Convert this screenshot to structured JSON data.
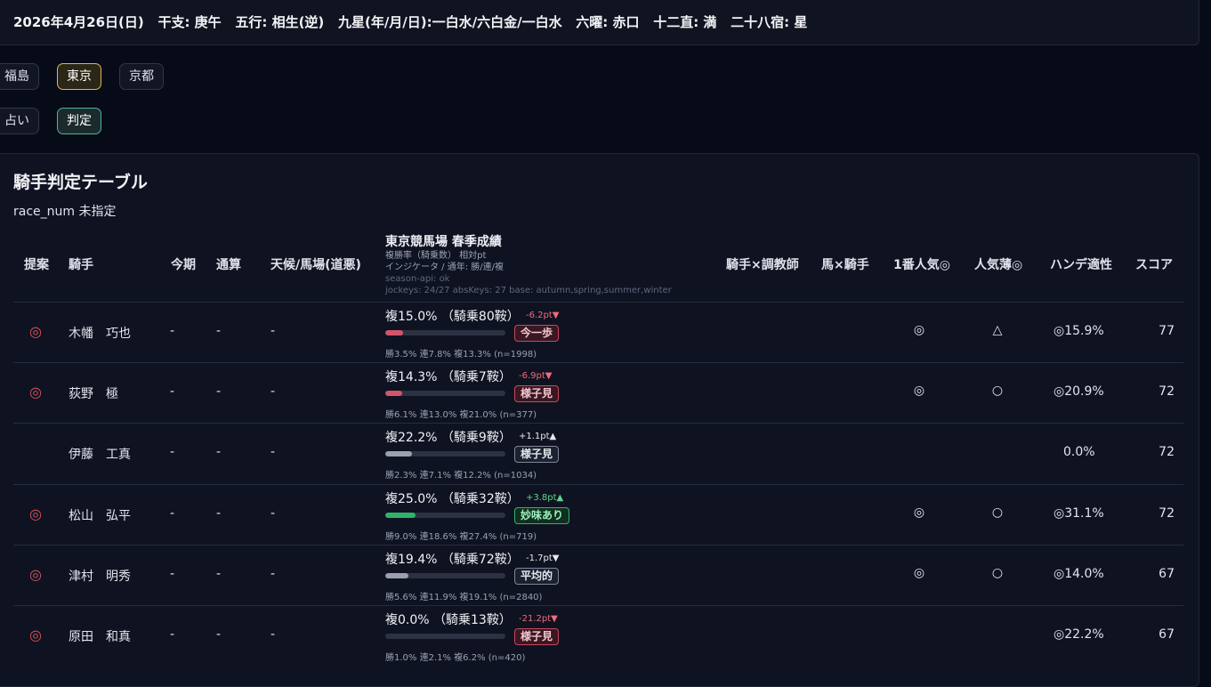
{
  "header": {
    "date": "2026年4月26日(日)",
    "eto": "干支: 庚午",
    "gogyo": "五行: 相生(逆)",
    "kusei": "九星(年/月/日):一白水/六白金/一白水",
    "rokuyo": "六曜: 赤口",
    "junichoku": "十二直: 満",
    "nijuhasshuku": "二十八宿: 星"
  },
  "venues": [
    "福島",
    "東京",
    "京都"
  ],
  "active_venue": "東京",
  "modes": [
    "占い",
    "判定"
  ],
  "active_mode": "判定",
  "panel": {
    "title": "騎手判定テーブル",
    "subtitle": "race_num 未指定"
  },
  "table": {
    "headers": {
      "suggest": "提案",
      "jockey": "騎手",
      "current": "今期",
      "total": "通算",
      "weather": "天候/馬場(道悪)",
      "venue_title": "東京競馬場 春季成績",
      "venue_line1": "複勝率（騎乗数） 相対pt",
      "venue_line2": "インジケータ / 通年: 勝/連/複",
      "venue_line3": "season-api: ok",
      "venue_line4": "jockeys: 24/27 absKeys: 27 base: autumn,spring,summer,winter",
      "trainer": "騎手×調教師",
      "horse": "馬×騎手",
      "fav1": "1番人気◎",
      "longshot": "人気薄◎",
      "handicap": "ハンデ適性",
      "score": "スコア"
    },
    "rows": [
      {
        "mark": "◎",
        "name": "木幡　巧也",
        "current": "-",
        "total": "-",
        "weather": "-",
        "rate": "複15.0% （騎乗80鞍）",
        "rate_value": 15.0,
        "delta": "-6.2pt▼",
        "delta_dir": "neg",
        "badge": "今一歩",
        "badge_kind": "red",
        "sub": "勝3.5% 連7.8% 複13.3% (n=1998)",
        "fav1": "◎",
        "longshot": "△",
        "handicap": "◎15.9%",
        "score": "77"
      },
      {
        "mark": "◎",
        "name": "荻野　極",
        "current": "-",
        "total": "-",
        "weather": "-",
        "rate": "複14.3% （騎乗7鞍）",
        "rate_value": 14.3,
        "delta": "-6.9pt▼",
        "delta_dir": "neg",
        "badge": "様子見",
        "badge_kind": "red",
        "sub": "勝6.1% 連13.0% 複21.0% (n=377)",
        "fav1": "◎",
        "longshot": "○",
        "handicap": "◎20.9%",
        "score": "72"
      },
      {
        "mark": "",
        "name": "伊藤　工真",
        "current": "-",
        "total": "-",
        "weather": "-",
        "rate": "複22.2% （騎乗9鞍）",
        "rate_value": 22.2,
        "delta": "+1.1pt▲",
        "delta_dir": "neu",
        "badge": "様子見",
        "badge_kind": "gray",
        "sub": "勝2.3% 連7.1% 複12.2% (n=1034)",
        "fav1": "",
        "longshot": "",
        "handicap": "0.0%",
        "score": "72"
      },
      {
        "mark": "◎",
        "name": "松山　弘平",
        "current": "-",
        "total": "-",
        "weather": "-",
        "rate": "複25.0% （騎乗32鞍）",
        "rate_value": 25.0,
        "delta": "+3.8pt▲",
        "delta_dir": "pos",
        "badge": "妙味あり",
        "badge_kind": "green",
        "sub": "勝9.0% 連18.6% 複27.4% (n=719)",
        "fav1": "◎",
        "longshot": "○",
        "handicap": "◎31.1%",
        "score": "72"
      },
      {
        "mark": "◎",
        "name": "津村　明秀",
        "current": "-",
        "total": "-",
        "weather": "-",
        "rate": "複19.4% （騎乗72鞍）",
        "rate_value": 19.4,
        "delta": "-1.7pt▼",
        "delta_dir": "neu",
        "badge": "平均的",
        "badge_kind": "gray",
        "sub": "勝5.6% 連11.9% 複19.1% (n=2840)",
        "fav1": "◎",
        "longshot": "○",
        "handicap": "◎14.0%",
        "score": "67"
      },
      {
        "mark": "◎",
        "name": "原田　和真",
        "current": "-",
        "total": "-",
        "weather": "-",
        "rate": "複0.0% （騎乗13鞍）",
        "rate_value": 0.0,
        "delta": "-21.2pt▼",
        "delta_dir": "neg",
        "badge": "様子見",
        "badge_kind": "red",
        "sub": "勝1.0% 連2.1% 複6.2% (n=420)",
        "fav1": "",
        "longshot": "",
        "handicap": "◎22.2%",
        "score": "67"
      }
    ]
  },
  "colors": {
    "bar_red": "#d2556a",
    "bar_gray": "#9aa0ae",
    "bar_green": "#2fb36b"
  }
}
